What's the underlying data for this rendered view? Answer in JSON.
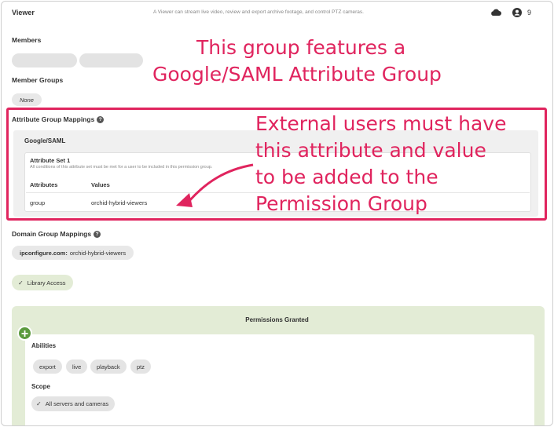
{
  "header": {
    "title": "Viewer",
    "description": "A Viewer can stream live video, review and export archive footage, and control PTZ cameras.",
    "user_count": "9"
  },
  "members": {
    "label": "Members"
  },
  "member_groups": {
    "label": "Member Groups",
    "value": "None"
  },
  "attribute_group_mappings": {
    "label": "Attribute Group Mappings",
    "provider": "Google/SAML",
    "attribute_set": {
      "title": "Attribute Set 1",
      "description": "All conditions of this attribute set must be met for a user to be included in this permission group.",
      "columns": [
        "Attributes",
        "Values"
      ],
      "rows": [
        {
          "attribute": "group",
          "value": "orchid-hybrid-viewers"
        }
      ]
    }
  },
  "annotations": {
    "top_line1": "This group features a",
    "top_line2": "Google/SAML Attribute Group",
    "side_line1": "External users must have",
    "side_line2": "this attribute and value",
    "side_line3": "to be added to the",
    "side_line4": "Permission Group",
    "color": "#e0245e"
  },
  "domain_group_mappings": {
    "label": "Domain Group Mappings",
    "domain": "ipconfigure.com:",
    "group": "orchid-hybrid-viewers"
  },
  "library_access": {
    "label": "Library Access"
  },
  "permissions": {
    "title": "Permissions Granted",
    "abilities_label": "Abilities",
    "abilities": [
      "export",
      "live",
      "playback",
      "ptz"
    ],
    "scope_label": "Scope",
    "scope_value": "All servers and cameras"
  },
  "colors": {
    "accent": "#e0245e",
    "permission_bg": "#e3ecd6",
    "add_button": "#5b9a3e"
  }
}
